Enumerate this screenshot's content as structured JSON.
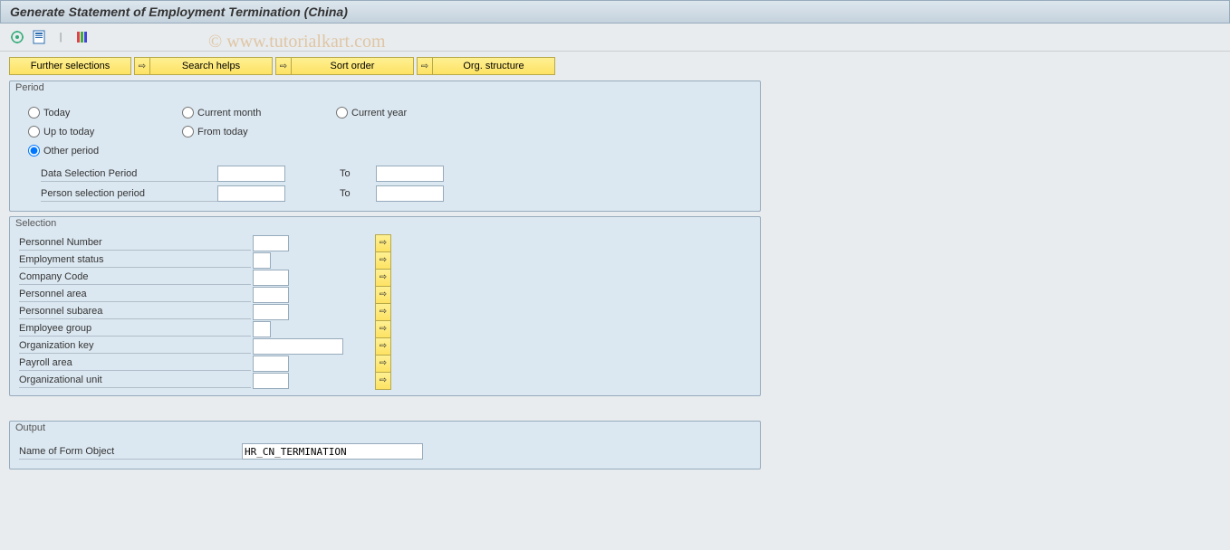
{
  "title": "Generate Statement of Employment Termination (China)",
  "watermark": "© www.tutorialkart.com",
  "buttons": {
    "further": "Further selections",
    "search": "Search helps",
    "sort": "Sort order",
    "org": "Org. structure"
  },
  "period": {
    "title": "Period",
    "options": {
      "today": "Today",
      "current_month": "Current month",
      "current_year": "Current year",
      "up_to_today": "Up to today",
      "from_today": "From today",
      "other": "Other period"
    },
    "data_sel_label": "Data Selection Period",
    "person_sel_label": "Person selection period",
    "to_label": "To",
    "data_from": "",
    "data_to": "",
    "person_from": "",
    "person_to": ""
  },
  "selection": {
    "title": "Selection",
    "fields": [
      {
        "label": "Personnel Number",
        "value": "",
        "width": "w40"
      },
      {
        "label": "Employment status",
        "value": "",
        "width": "w20"
      },
      {
        "label": "Company Code",
        "value": "",
        "width": "w40"
      },
      {
        "label": "Personnel area",
        "value": "",
        "width": "w40"
      },
      {
        "label": "Personnel subarea",
        "value": "",
        "width": "w40"
      },
      {
        "label": "Employee group",
        "value": "",
        "width": "w20"
      },
      {
        "label": "Organization key",
        "value": "",
        "width": "w100"
      },
      {
        "label": "Payroll area",
        "value": "",
        "width": "w40"
      },
      {
        "label": "Organizational unit",
        "value": "",
        "width": "w40"
      }
    ]
  },
  "output": {
    "title": "Output",
    "form_label": "Name of Form Object",
    "form_value": "HR_CN_TERMINATION"
  }
}
